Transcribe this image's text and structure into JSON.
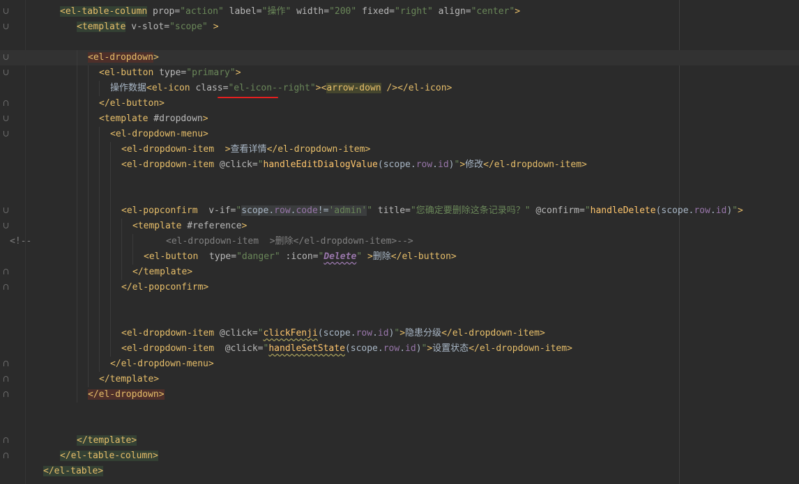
{
  "editor": {
    "lines": [
      {
        "indent": 86,
        "fold": "down",
        "parts": [
          {
            "c": "t",
            "hl": "hl-green",
            "v": "<el-table-column"
          },
          {
            "c": "a",
            "v": " prop="
          },
          {
            "c": "s",
            "v": "\"action\""
          },
          {
            "c": "a",
            "v": " label="
          },
          {
            "c": "s",
            "v": "\"操作\""
          },
          {
            "c": "a",
            "v": " width="
          },
          {
            "c": "s",
            "v": "\"200\""
          },
          {
            "c": "a",
            "v": " fixed="
          },
          {
            "c": "s",
            "v": "\"right\""
          },
          {
            "c": "a",
            "v": " align="
          },
          {
            "c": "s",
            "v": "\"center\""
          },
          {
            "c": "t",
            "v": ">"
          }
        ]
      },
      {
        "indent": 110,
        "fold": "down",
        "parts": [
          {
            "c": "t",
            "hl": "hl-green",
            "v": "<template"
          },
          {
            "c": "a",
            "v": " v-slot="
          },
          {
            "c": "s",
            "v": "\"scope\""
          },
          {
            "c": "t",
            "v": " >"
          }
        ]
      },
      {
        "indent": 110,
        "parts": []
      },
      {
        "indent": 126,
        "fold": "down",
        "current": true,
        "caret": true,
        "parts": [
          {
            "c": "t",
            "hl": "hl-red",
            "v": "<e"
          },
          {
            "c": "caret",
            "v": ""
          },
          {
            "c": "t",
            "hl": "hl-red",
            "v": "l-dropdown"
          },
          {
            "c": "t",
            "v": ">"
          }
        ]
      },
      {
        "indent": 142,
        "fold": "down",
        "parts": [
          {
            "c": "t",
            "v": "<el-button"
          },
          {
            "c": "a",
            "v": " type="
          },
          {
            "c": "s",
            "v": "\"primary\""
          },
          {
            "c": "t",
            "v": ">"
          }
        ]
      },
      {
        "indent": 158,
        "parts": [
          {
            "c": "p",
            "v": "操作数据"
          },
          {
            "c": "t",
            "v": "<el-icon"
          },
          {
            "c": "a",
            "v": " class="
          },
          {
            "c": "s",
            "v": "\"el-icon--right\""
          },
          {
            "c": "t",
            "v": "><"
          },
          {
            "c": "t",
            "hl": "hl-olive",
            "v": "arrow-down"
          },
          {
            "c": "t",
            "v": " /></el-icon>"
          }
        ]
      },
      {
        "indent": 142,
        "fold": "up",
        "parts": [
          {
            "c": "t",
            "v": "</el-button>"
          }
        ]
      },
      {
        "indent": 142,
        "fold": "down",
        "parts": [
          {
            "c": "t",
            "v": "<template"
          },
          {
            "c": "a",
            "v": " #dropdown"
          },
          {
            "c": "t",
            "v": ">"
          }
        ]
      },
      {
        "indent": 158,
        "fold": "down",
        "parts": [
          {
            "c": "t",
            "v": "<el-dropdown-menu>"
          }
        ]
      },
      {
        "indent": 174,
        "parts": [
          {
            "c": "t",
            "v": "<el-dropdown-item"
          },
          {
            "c": "t",
            "v": "  >"
          },
          {
            "c": "p",
            "v": "查看详情"
          },
          {
            "c": "t",
            "v": "</el-dropdown-item>"
          }
        ]
      },
      {
        "indent": 174,
        "parts": [
          {
            "c": "t",
            "v": "<el-dropdown-item"
          },
          {
            "c": "a",
            "v": " @click="
          },
          {
            "c": "s",
            "v": "\""
          },
          {
            "c": "fn",
            "v": "handleEditDialogValue"
          },
          {
            "c": "p",
            "v": "(scope."
          },
          {
            "c": "pr",
            "v": "row"
          },
          {
            "c": "p",
            "v": "."
          },
          {
            "c": "pr",
            "v": "id"
          },
          {
            "c": "p",
            "v": ")"
          },
          {
            "c": "s",
            "v": "\""
          },
          {
            "c": "t",
            "v": ">"
          },
          {
            "c": "p",
            "v": "修改"
          },
          {
            "c": "t",
            "v": "</el-dropdown-item>"
          }
        ]
      },
      {
        "indent": 174,
        "parts": []
      },
      {
        "indent": 174,
        "parts": []
      },
      {
        "indent": 174,
        "fold": "down",
        "parts": [
          {
            "c": "t",
            "v": "<el-popconfirm"
          },
          {
            "c": "a",
            "v": "  v-if="
          },
          {
            "c": "s",
            "v": "\""
          },
          {
            "c": "p",
            "hl": "hl-gray",
            "v": "scope."
          },
          {
            "c": "pr",
            "hl": "hl-gray",
            "v": "row"
          },
          {
            "c": "p",
            "hl": "hl-gray",
            "v": "."
          },
          {
            "c": "pr",
            "hl": "hl-gray",
            "v": "code"
          },
          {
            "c": "p",
            "hl": "hl-gray",
            "v": "!="
          },
          {
            "c": "s",
            "hl": "hl-gray",
            "v": "'admin'"
          },
          {
            "c": "s",
            "v": "\""
          },
          {
            "c": "a",
            "v": " title="
          },
          {
            "c": "s",
            "v": "\"您确定要删除这条记录吗？\""
          },
          {
            "c": "a",
            "v": " @confirm="
          },
          {
            "c": "s",
            "v": "\""
          },
          {
            "c": "fn",
            "v": "handleDelete"
          },
          {
            "c": "p",
            "v": "(scope."
          },
          {
            "c": "pr",
            "v": "row"
          },
          {
            "c": "p",
            "v": "."
          },
          {
            "c": "pr",
            "v": "id"
          },
          {
            "c": "p",
            "v": ")"
          },
          {
            "c": "s",
            "v": "\""
          },
          {
            "c": "t",
            "v": ">"
          }
        ]
      },
      {
        "indent": 190,
        "fold": "down",
        "parts": [
          {
            "c": "t",
            "v": "<template"
          },
          {
            "c": "a",
            "v": " #reference"
          },
          {
            "c": "t",
            "v": ">"
          }
        ]
      },
      {
        "indent": 238,
        "comment": "<!--",
        "parts": [
          {
            "c": "c",
            "v": "<el-dropdown-item  >删除</el-dropdown-item>-->"
          }
        ]
      },
      {
        "indent": 206,
        "parts": [
          {
            "c": "t",
            "v": "<el-button"
          },
          {
            "c": "a",
            "v": "  type="
          },
          {
            "c": "s",
            "v": "\"danger\""
          },
          {
            "c": "a",
            "v": " :icon="
          },
          {
            "c": "s",
            "v": "\""
          },
          {
            "c": "italic",
            "v": "Delete"
          },
          {
            "c": "s",
            "v": "\""
          },
          {
            "c": "t",
            "v": " >"
          },
          {
            "c": "p",
            "v": "删除"
          },
          {
            "c": "t",
            "v": "</el-button>"
          }
        ]
      },
      {
        "indent": 190,
        "fold": "up",
        "parts": [
          {
            "c": "t",
            "v": "</template>"
          }
        ]
      },
      {
        "indent": 174,
        "fold": "up",
        "parts": [
          {
            "c": "t",
            "v": "</el-popconfirm>"
          }
        ]
      },
      {
        "indent": 174,
        "parts": []
      },
      {
        "indent": 174,
        "parts": []
      },
      {
        "indent": 174,
        "parts": [
          {
            "c": "t",
            "v": "<el-dropdown-item"
          },
          {
            "c": "a",
            "v": " @click="
          },
          {
            "c": "s",
            "v": "\""
          },
          {
            "c": "fn",
            "wave": true,
            "v": "clickFenji"
          },
          {
            "c": "p",
            "v": "(scope."
          },
          {
            "c": "pr",
            "v": "row"
          },
          {
            "c": "p",
            "v": "."
          },
          {
            "c": "pr",
            "v": "id"
          },
          {
            "c": "p",
            "v": ")"
          },
          {
            "c": "s",
            "v": "\""
          },
          {
            "c": "t",
            "v": ">"
          },
          {
            "c": "p",
            "v": "隐患分级"
          },
          {
            "c": "t",
            "v": "</el-dropdown-item>"
          }
        ]
      },
      {
        "indent": 174,
        "parts": [
          {
            "c": "t",
            "v": "<el-dropdown-item"
          },
          {
            "c": "a",
            "v": "  @click="
          },
          {
            "c": "s",
            "v": "\""
          },
          {
            "c": "fn",
            "wave": true,
            "v": "handleSetState"
          },
          {
            "c": "p",
            "v": "(scope."
          },
          {
            "c": "pr",
            "v": "row"
          },
          {
            "c": "p",
            "v": "."
          },
          {
            "c": "pr",
            "v": "id"
          },
          {
            "c": "p",
            "v": ")"
          },
          {
            "c": "s",
            "v": "\""
          },
          {
            "c": "t",
            "v": ">"
          },
          {
            "c": "p",
            "v": "设置状态"
          },
          {
            "c": "t",
            "v": "</el-dropdown-item>"
          }
        ]
      },
      {
        "indent": 158,
        "fold": "up",
        "parts": [
          {
            "c": "t",
            "v": "</el-dropdown-menu>"
          }
        ]
      },
      {
        "indent": 142,
        "fold": "up",
        "parts": [
          {
            "c": "t",
            "v": "</template>"
          }
        ]
      },
      {
        "indent": 126,
        "fold": "up",
        "parts": [
          {
            "c": "t",
            "hl": "hl-red",
            "v": "</el-dropdown>"
          }
        ]
      },
      {
        "indent": 110,
        "parts": []
      },
      {
        "indent": 110,
        "parts": []
      },
      {
        "indent": 110,
        "fold": "up",
        "parts": [
          {
            "c": "t",
            "hl": "hl-green",
            "v": "</template>"
          }
        ]
      },
      {
        "indent": 86,
        "fold": "up",
        "parts": [
          {
            "c": "t",
            "hl": "hl-green",
            "v": "</el-table-column>"
          }
        ]
      },
      {
        "indent": 62,
        "parts": [
          {
            "c": "t",
            "hl": "hl-green",
            "v": "</el-table>"
          }
        ]
      }
    ]
  }
}
